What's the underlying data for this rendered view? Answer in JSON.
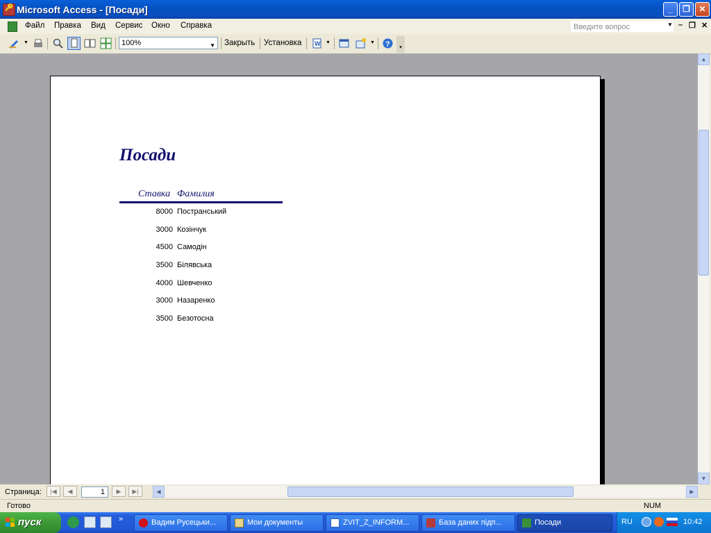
{
  "window": {
    "title": "Microsoft Access - [Посади]"
  },
  "menu": {
    "items": [
      "Файл",
      "Правка",
      "Вид",
      "Сервис",
      "Окно",
      "Справка"
    ],
    "help_placeholder": "Введите вопрос"
  },
  "toolbar": {
    "zoom": "100%",
    "close_label": "Закрыть",
    "setup_label": "Установка"
  },
  "report": {
    "title": "Посади",
    "columns": [
      "Ставка",
      "Фамилия"
    ],
    "rows": [
      {
        "rate": "8000",
        "name": "Постранський"
      },
      {
        "rate": "3000",
        "name": "Козінчук"
      },
      {
        "rate": "4500",
        "name": "Самодін"
      },
      {
        "rate": "3500",
        "name": "Білявська"
      },
      {
        "rate": "4000",
        "name": "Шевченко"
      },
      {
        "rate": "3000",
        "name": "Назаренко"
      },
      {
        "rate": "3500",
        "name": "Безотосна"
      }
    ]
  },
  "nav": {
    "page_label": "Страница:",
    "page_number": "1"
  },
  "status": {
    "text": "Готово",
    "num": "NUM"
  },
  "taskbar": {
    "start": "пуск",
    "tasks": [
      "Вадим Русецьки...",
      "Мои документы",
      "ZVIT_Z_INFORM...",
      "База даних підп...",
      "Посади"
    ],
    "lang": "RU",
    "clock": "10:42"
  },
  "colors": {
    "report_title": "#10106e",
    "titlebar": "#0453c4",
    "workspace": "#a6a6aa"
  }
}
